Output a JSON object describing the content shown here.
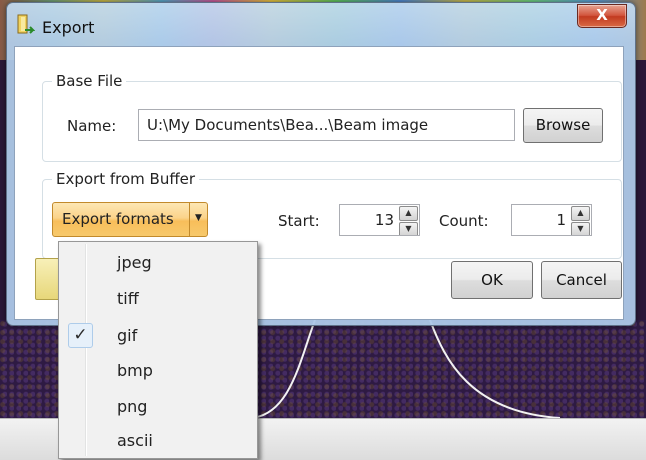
{
  "dialog": {
    "title": "Export",
    "close_label": "X"
  },
  "base_file": {
    "legend": "Base File",
    "name_label": "Name:",
    "name_value": "U:\\My Documents\\Bea...\\Beam image",
    "browse_label": "Browse"
  },
  "export_buffer": {
    "legend": "Export from Buffer",
    "formats_button_label": "Export formats",
    "start_label": "Start:",
    "start_value": "13",
    "count_label": "Count:",
    "count_value": "1"
  },
  "footer": {
    "ok_label": "OK",
    "cancel_label": "Cancel"
  },
  "format_menu": {
    "items": [
      {
        "label": "jpeg",
        "checked": false
      },
      {
        "label": "tiff",
        "checked": false
      },
      {
        "label": "gif",
        "checked": true
      },
      {
        "label": "bmp",
        "checked": false
      },
      {
        "label": "png",
        "checked": false
      },
      {
        "label": "ascii",
        "checked": false
      }
    ],
    "check_glyph": "✓"
  },
  "icons": {
    "spin_up": "up-arrow-icon",
    "spin_down": "down-arrow-icon",
    "dropdown": "chevron-down-icon"
  }
}
